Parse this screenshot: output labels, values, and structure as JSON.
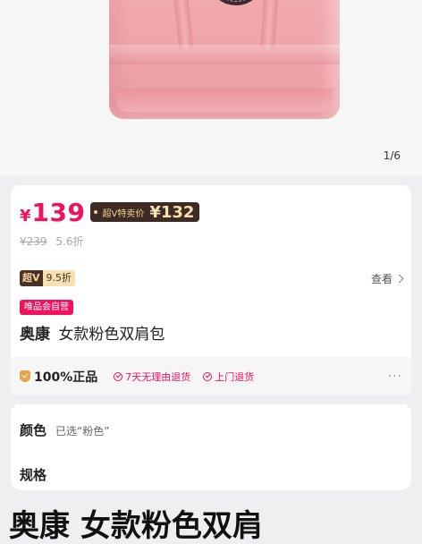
{
  "gallery": {
    "counter": "1/6"
  },
  "price": {
    "currency": "¥",
    "amount": "139",
    "vip_label": "超V特卖价",
    "vip_price": "¥132",
    "original": "¥239",
    "discount": "5.6折"
  },
  "super_vip": {
    "badge": "超V",
    "rate": "9.5折",
    "view_label": "查看"
  },
  "product": {
    "self_tag": "唯品会自营",
    "brand": "奥康",
    "name": "女款粉色双肩包"
  },
  "services": {
    "genuine": "100%正品",
    "items": [
      "7天无理由退货",
      "上门退货"
    ],
    "more": "···"
  },
  "options": {
    "color_label": "颜色",
    "color_value": "已选“粉色”",
    "spec_label": "规格"
  },
  "headline": "奥康 女款粉色双肩"
}
